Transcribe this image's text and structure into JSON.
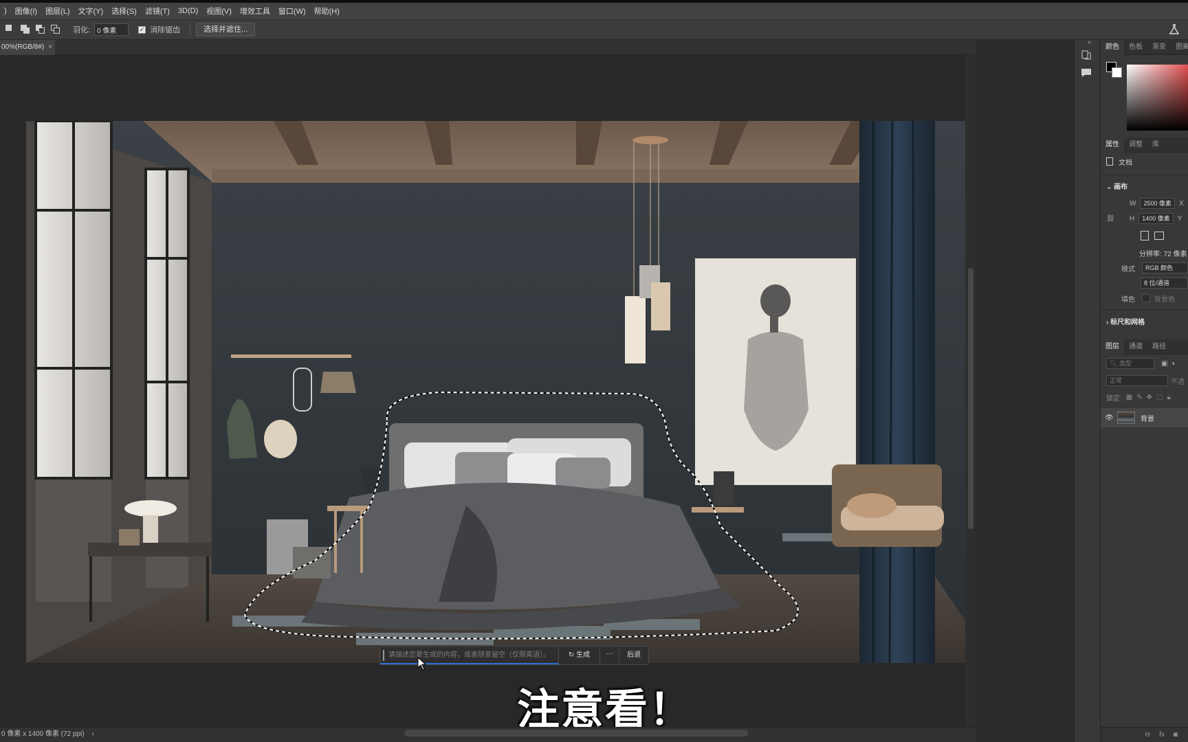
{
  "menu": {
    "items": [
      ")",
      "图像(I)",
      "图层(L)",
      "文字(Y)",
      "选择(S)",
      "滤镜(T)",
      "3D(D)",
      "视图(V)",
      "增效工具",
      "窗口(W)",
      "帮助(H)"
    ]
  },
  "options": {
    "feather_label": "羽化:",
    "feather_value": "0 像素",
    "antialias_label": "消除锯齿",
    "select_mask_label": "选择并遮住..."
  },
  "document": {
    "tab_label": "00%(RGB/8#)",
    "tab_close": "×",
    "status_text": "0 像素 x 1400 像素 (72 ppi)",
    "status_arrow": "›"
  },
  "generative_bar": {
    "placeholder": "请描述您要生成的内容，或者随意留空（仅限英语）。",
    "generate_label": "生成",
    "more_label": "···",
    "back_label": "后退"
  },
  "subtitle": "注意看！",
  "color_panel": {
    "tabs": [
      "颜色",
      "色板",
      "渐变",
      "图案"
    ]
  },
  "properties_panel": {
    "tabs": [
      "属性",
      "调整",
      "库"
    ],
    "doc_label": "文档",
    "canvas_section": "画布",
    "w_label": "W",
    "w_value": "2500 像素",
    "x_label": "X",
    "h_label": "H",
    "h_value": "1400 像素",
    "y_label": "Y",
    "resolution": "分辨率: 72 像素",
    "mode_label": "模式",
    "mode_value": "RGB 颜色",
    "depth_value": "8 位/通道",
    "fill_label": "填色",
    "fill_value": "背景色",
    "rulers_section": "标尺和网格"
  },
  "layers_panel": {
    "tabs": [
      "图层",
      "通道",
      "路径"
    ],
    "search_placeholder": "类型",
    "blend_mode": "正常",
    "opacity_label": "不透",
    "lock_label": "锁定:",
    "layer_name": "背景"
  },
  "colors": {
    "accent": "#2f6fd6",
    "panel": "#383838",
    "canvas_bg": "#282828"
  }
}
